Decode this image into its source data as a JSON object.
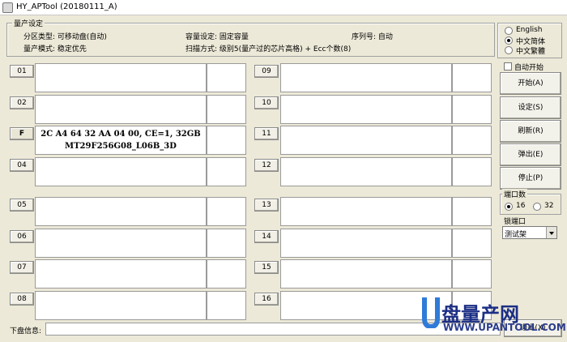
{
  "window": {
    "title": "HY_APTool (20180111_A)"
  },
  "settings": {
    "group_label": "量产设定",
    "partition_type": "分区类型: 可移动盘(自动)",
    "capacity_setting": "容量设定: 固定容量",
    "serial_number": "序列号: 自动",
    "production_mode": "量产模式: 稳定优先",
    "scan_mode": "扫描方式: 级别5(量产过的芯片高格) + Ecc个数(8)"
  },
  "slots_left": [
    {
      "label": "01",
      "text1": "",
      "text2": ""
    },
    {
      "label": "02",
      "text1": "",
      "text2": ""
    },
    {
      "label": "F",
      "text1": "2C A4 64 32 AA 04 00, CE=1, 32GB",
      "text2": "MT29F256G08_L06B_3D"
    },
    {
      "label": "04",
      "text1": "",
      "text2": ""
    },
    {
      "label": "05",
      "text1": "",
      "text2": ""
    },
    {
      "label": "06",
      "text1": "",
      "text2": ""
    },
    {
      "label": "07",
      "text1": "",
      "text2": ""
    },
    {
      "label": "08",
      "text1": "",
      "text2": ""
    }
  ],
  "slots_right": [
    {
      "label": "09"
    },
    {
      "label": "10"
    },
    {
      "label": "11"
    },
    {
      "label": "12"
    },
    {
      "label": "13"
    },
    {
      "label": "14"
    },
    {
      "label": "15"
    },
    {
      "label": "16"
    }
  ],
  "language": {
    "options": [
      "English",
      "中文简体",
      "中文繁體"
    ],
    "selected": "中文简体"
  },
  "auto_start": {
    "label": "自动开始",
    "checked": false
  },
  "actions": {
    "start": "开始(A)",
    "settings": "设定(S)",
    "refresh": "刷新(R)",
    "eject": "弹出(E)",
    "stop": "停止(P)"
  },
  "port_count": {
    "label": "端口数",
    "options": [
      "16",
      "32"
    ],
    "selected": "16"
  },
  "lock_port": {
    "label": "锁端口",
    "value": "测试架"
  },
  "status": {
    "label": "下盘信息:",
    "value": ""
  },
  "exit_button": "退出(X)",
  "watermark": {
    "brand": "盘量产网",
    "url": "WWW.UPANTOOL.COM"
  },
  "colors": {
    "background": "#ece9d8",
    "watermark_blue": "#1c2f85"
  }
}
